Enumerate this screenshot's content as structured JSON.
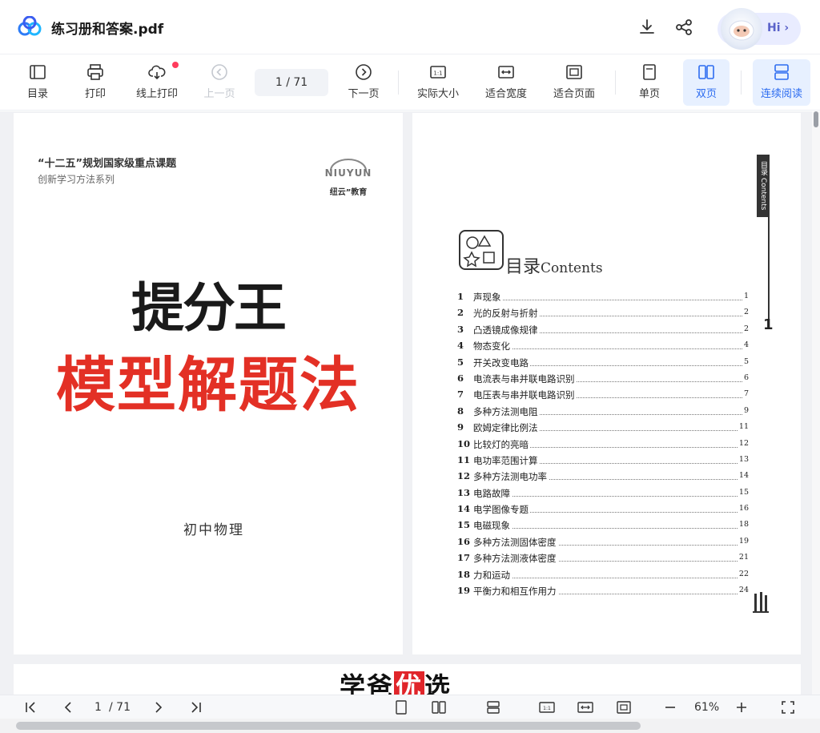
{
  "header": {
    "file_title": "练习册和答案.pdf",
    "hi_label": "Hi ›"
  },
  "toolbar": {
    "toc": "目录",
    "print": "打印",
    "online_print": "线上打印",
    "prev_page": "上一页",
    "page_current": "1",
    "page_total": "/ 71",
    "next_page": "下一页",
    "actual_size": "实际大小",
    "fit_width": "适合宽度",
    "fit_page": "适合页面",
    "single_page": "单页",
    "double_page": "双页",
    "continuous": "连续阅读"
  },
  "cover": {
    "series_line1": "“十二五”规划国家级重点课题",
    "series_line2": "创新学习方法系列",
    "brand": "NIUYUN",
    "brand_cn": "纽云”教育",
    "title1": "提分王",
    "title2": "模型解题法",
    "subject": "初中物理"
  },
  "toc_page": {
    "side_label": "目录 Contents",
    "page_marker": "1",
    "heading_cn": "目录",
    "heading_en": "Contents",
    "entries": [
      {
        "num": "1",
        "title": "声现象",
        "page": "1"
      },
      {
        "num": "2",
        "title": "光的反射与折射",
        "page": "2"
      },
      {
        "num": "3",
        "title": "凸透镜成像规律",
        "page": "2"
      },
      {
        "num": "4",
        "title": "物态变化",
        "page": "4"
      },
      {
        "num": "5",
        "title": "开关改变电路",
        "page": "5"
      },
      {
        "num": "6",
        "title": "电流表与串并联电路识别",
        "page": "6"
      },
      {
        "num": "7",
        "title": "电压表与串并联电路识别",
        "page": "7"
      },
      {
        "num": "8",
        "title": "多种方法测电阻",
        "page": "9"
      },
      {
        "num": "9",
        "title": "欧姆定律比例法",
        "page": "11"
      },
      {
        "num": "10",
        "title": "比较灯的亮暗",
        "page": "12"
      },
      {
        "num": "11",
        "title": "电功率范围计算",
        "page": "13"
      },
      {
        "num": "12",
        "title": "多种方法测电功率",
        "page": "14"
      },
      {
        "num": "13",
        "title": "电路故障",
        "page": "15"
      },
      {
        "num": "14",
        "title": "电学图像专题",
        "page": "16"
      },
      {
        "num": "15",
        "title": "电磁现象",
        "page": "18"
      },
      {
        "num": "16",
        "title": "多种方法测固体密度",
        "page": "19"
      },
      {
        "num": "17",
        "title": "多种方法测液体密度",
        "page": "21"
      },
      {
        "num": "18",
        "title": "力和运动",
        "page": "22"
      },
      {
        "num": "19",
        "title": "平衡力和相互作用力",
        "page": "24"
      }
    ]
  },
  "watermark": {
    "part1": "学爸",
    "part2": "优",
    "part3": "选"
  },
  "bottom_bar": {
    "page_current": "1",
    "page_total": "/ 71",
    "zoom": "61%"
  },
  "colors": {
    "accent": "#2d6cf0",
    "active_bg": "#e7f0ff",
    "cover_red": "#e33025"
  }
}
